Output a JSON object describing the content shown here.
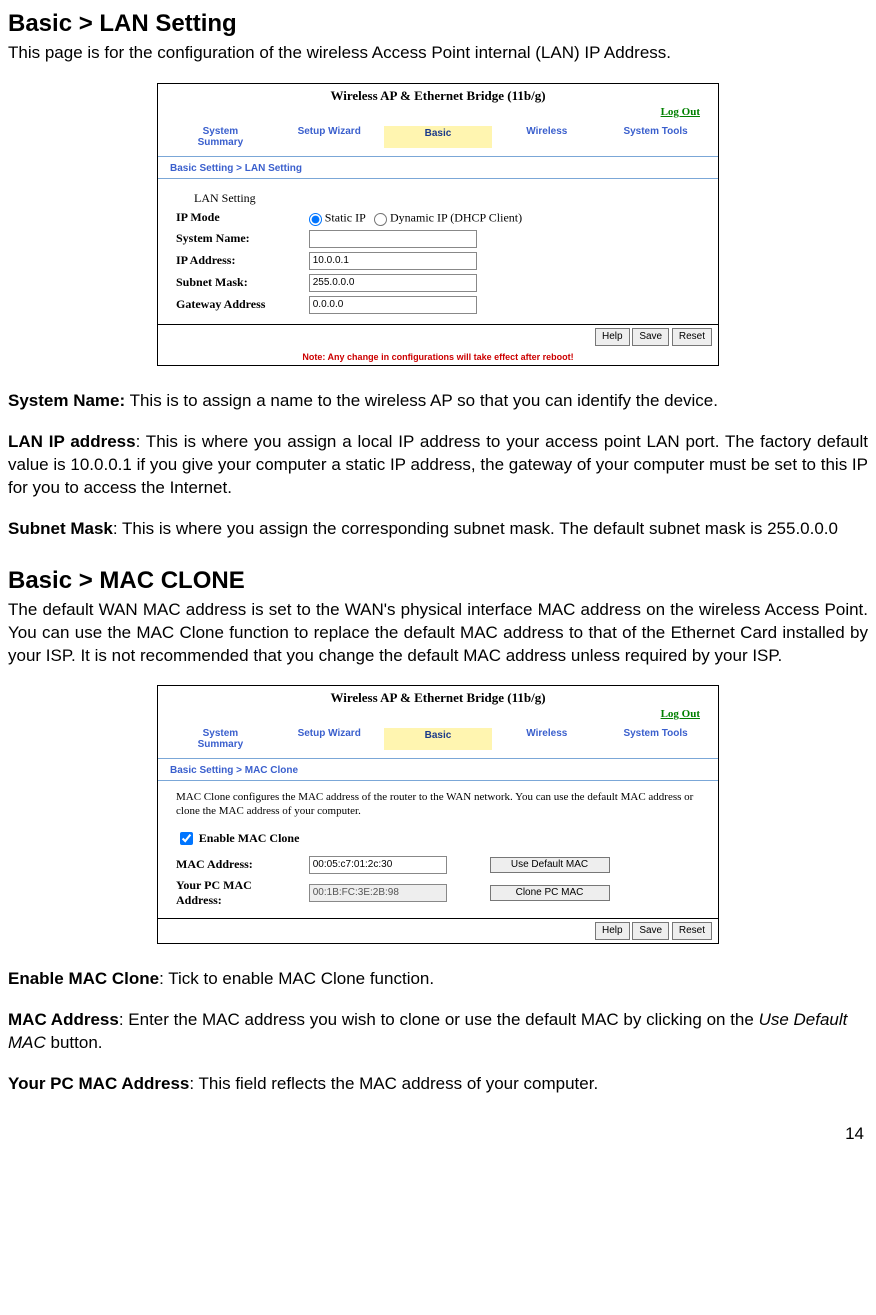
{
  "doc": {
    "section1": {
      "heading": "Basic > LAN Setting",
      "intro": "This page is for the configuration of the wireless Access Point internal (LAN) IP Address.",
      "def1_label": "System Name:",
      "def1_text": " This is to assign a name to the wireless AP so that you can identify the device.",
      "def2_label": "LAN IP address",
      "def2_text": ": This is where you assign a local IP address to your access point LAN port. The factory default value is 10.0.0.1 if you give your computer a static IP address, the gateway of your computer must be set to this IP for you to access the Internet.",
      "def3_label": "Subnet Mask",
      "def3_text": ": This is where you assign the corresponding subnet mask. The default subnet mask is 255.0.0.0"
    },
    "section2": {
      "heading": "Basic > MAC CLONE",
      "intro": "The default WAN MAC address is set to the WAN's physical interface MAC address on the wireless Access Point. You can use the MAC Clone function to replace the default MAC address to that of the Ethernet Card installed by your ISP. It is not recommended that you change the default MAC address unless required by your ISP.",
      "def1_label": "Enable MAC Clone",
      "def1_text": ": Tick to enable MAC Clone function.",
      "def2_label": "MAC Address",
      "def2_text_a": ": Enter the MAC address you wish to clone or use the default MAC by clicking on the ",
      "def2_text_i": "Use Default MAC",
      "def2_text_b": " button.",
      "def3_label": "Your PC MAC Address",
      "def3_text": ": This field reflects the MAC address of your computer."
    },
    "page_number": "14"
  },
  "panel_common": {
    "title": "Wireless AP & Ethernet Bridge (11b/g)",
    "logout": "Log Out",
    "nav": {
      "system_summary_a": "System",
      "system_summary_b": "Summary",
      "setup_wizard": "Setup Wizard",
      "basic": "Basic",
      "wireless": "Wireless",
      "system_tools": "System Tools"
    },
    "buttons": {
      "help": "Help",
      "save": "Save",
      "reset": "Reset"
    },
    "note": "Note: Any change in configurations will take effect after reboot!"
  },
  "lan_panel": {
    "breadcrumb": "Basic Setting > LAN Setting",
    "section_label": "LAN Setting",
    "rows": {
      "ip_mode": "IP Mode",
      "static_ip": "Static IP",
      "dynamic_ip": "Dynamic IP (DHCP Client)",
      "system_name": "System Name:",
      "ip_address": "IP Address:",
      "subnet_mask": "Subnet Mask:",
      "gateway": "Gateway Address"
    },
    "values": {
      "system_name": "",
      "ip_address": "10.0.0.1",
      "subnet_mask": "255.0.0.0",
      "gateway": "0.0.0.0"
    }
  },
  "mac_panel": {
    "breadcrumb": "Basic Setting > MAC Clone",
    "clone_msg": "MAC Clone configures the MAC address of the router to the WAN network. You can use the default MAC address or clone the MAC address of your computer.",
    "enable_label": "Enable MAC Clone",
    "rows": {
      "mac_address": "MAC Address:",
      "pc_mac_a": "Your PC MAC",
      "pc_mac_b": "Address:"
    },
    "values": {
      "mac_address": "00:05:c7:01:2c:30",
      "pc_mac": "00:1B:FC:3E:2B:98"
    },
    "buttons": {
      "use_default": "Use Default MAC",
      "clone_pc": "Clone PC MAC"
    }
  }
}
